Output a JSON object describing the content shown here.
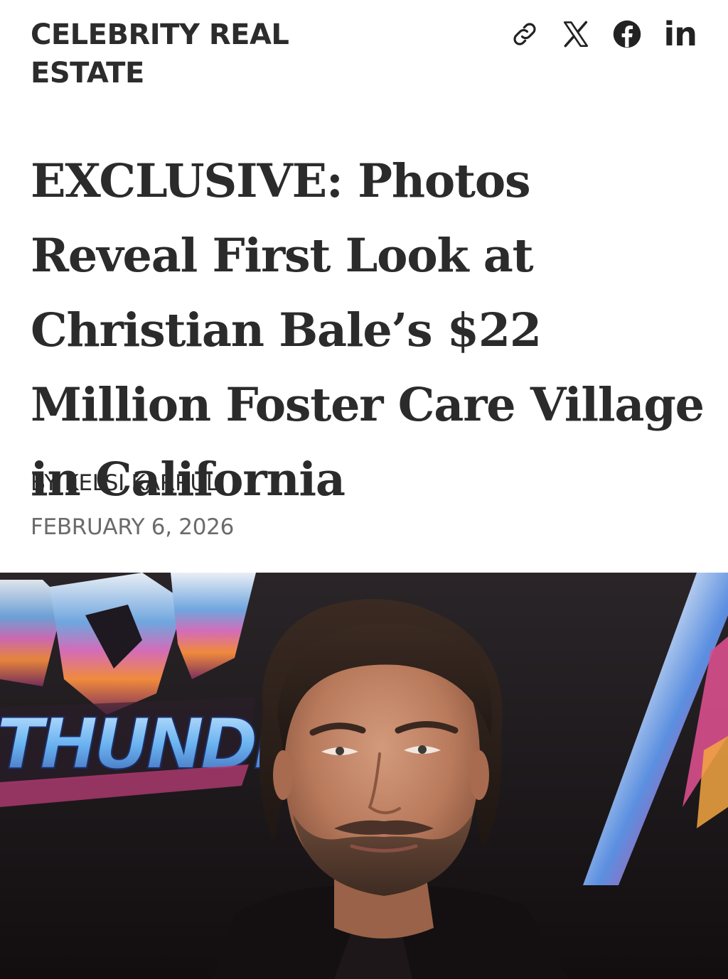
{
  "header": {
    "category": "CELEBRITY REAL ESTATE",
    "share": {
      "link_icon": "link-icon",
      "x_icon": "x-logo-icon",
      "facebook_icon": "facebook-icon",
      "linkedin_icon": "linkedin-icon",
      "linkedin_text": "in"
    }
  },
  "article": {
    "headline": "EXCLUSIVE: Photos Reveal First Look at Christian Bale’s $22 Million Foster Care Village in California",
    "byline_prefix": "BY",
    "author": "KELSI KARRULI",
    "date": "FEBRUARY 6, 2026"
  },
  "hero": {
    "backdrop_text": "THUNDE",
    "backdrop_text_top": "OR"
  },
  "colors": {
    "text": "#2b2b2b",
    "muted": "#6b6b6b",
    "backdrop_dark": "#1a1416"
  }
}
